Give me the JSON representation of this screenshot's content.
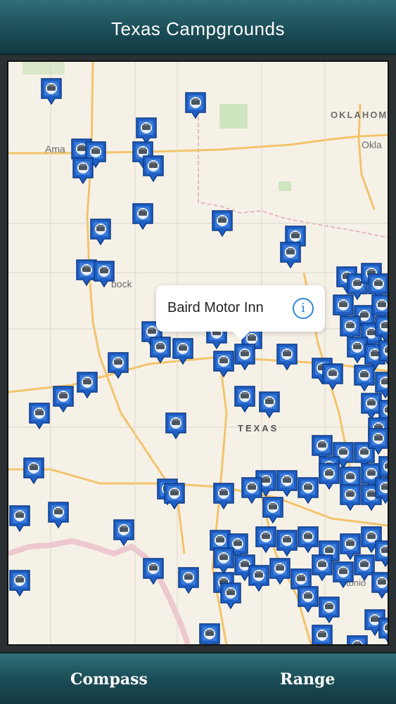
{
  "header": {
    "title": "Texas Campgrounds"
  },
  "map": {
    "labels": {
      "oklahoma": "OKLAHOM",
      "okla_city": "Okla",
      "amarillo": "Ama",
      "lubbock": "bock",
      "texas": "TEXAS",
      "san_antonio": "tonio"
    },
    "callout": {
      "title": "Baird Motor Inn",
      "info_icon": "info-icon"
    },
    "pin_icon": "campground-pin-icon",
    "colors": {
      "pin_blue": "#1f5fc4",
      "land": "#f6f1e7",
      "highway": "#f2c46b",
      "border": "#e9b6c4"
    }
  },
  "toolbar": {
    "compass_label": "Compass",
    "range_label": "Range"
  }
}
